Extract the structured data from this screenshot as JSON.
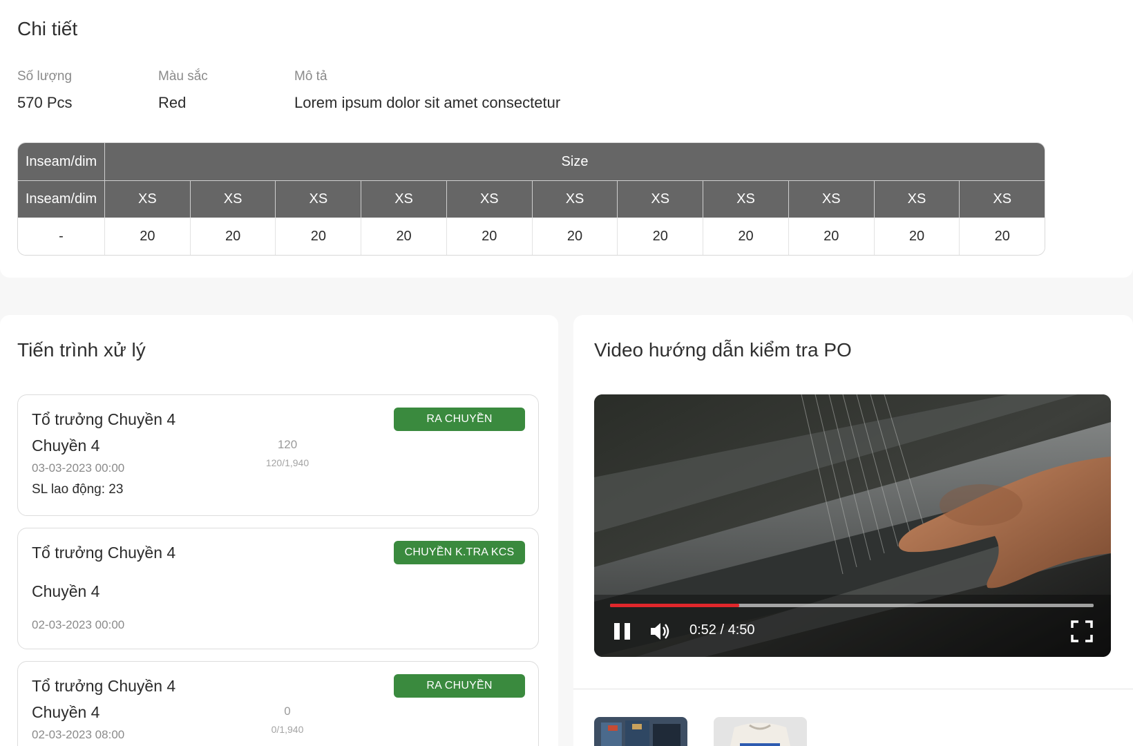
{
  "details": {
    "title": "Chi tiết",
    "quantity_label": "Số lượng",
    "quantity_value": "570 Pcs",
    "color_label": "Màu sắc",
    "color_value": "Red",
    "description_label": "Mô tả",
    "description_value": "Lorem ipsum dolor sit amet consectetur",
    "table": {
      "header_first": "Inseam/dim",
      "header_group": "Size",
      "subheader_first": "Inseam/dim",
      "sizes": [
        "XS",
        "XS",
        "XS",
        "XS",
        "XS",
        "XS",
        "XS",
        "XS",
        "XS",
        "XS",
        "XS"
      ],
      "row_first": "-",
      "row_values": [
        "20",
        "20",
        "20",
        "20",
        "20",
        "20",
        "20",
        "20",
        "20",
        "20",
        "20"
      ]
    }
  },
  "progress": {
    "title": "Tiến trình xử lý",
    "items": [
      {
        "title": "Tổ trưởng Chuyền 4",
        "line": "Chuyền 4",
        "date": "03-03-2023 00:00",
        "labor": "SL lao động: 23",
        "badge": "RA CHUYỀN",
        "count": "120",
        "ratio": "120/1,940"
      },
      {
        "title": "Tổ trưởng Chuyền 4",
        "line": "Chuyền 4",
        "date": "02-03-2023 00:00",
        "badge": "CHUYỀN K.TRA KCS"
      },
      {
        "title": "Tổ trưởng Chuyền 4",
        "line": "Chuyền 4",
        "date": "02-03-2023 08:00",
        "badge": "RA CHUYỀN",
        "count": "0",
        "ratio": "0/1,940"
      }
    ]
  },
  "video": {
    "title": "Video hướng dẫn kiểm tra PO",
    "time": "0:52 / 4:50",
    "progress_fraction": 0.267,
    "accent_color": "#e0272b",
    "controls": [
      "pause-icon",
      "volume-icon",
      "fullscreen-icon"
    ]
  },
  "colors": {
    "badge_green": "#3a8a3e",
    "table_header": "#666666"
  }
}
